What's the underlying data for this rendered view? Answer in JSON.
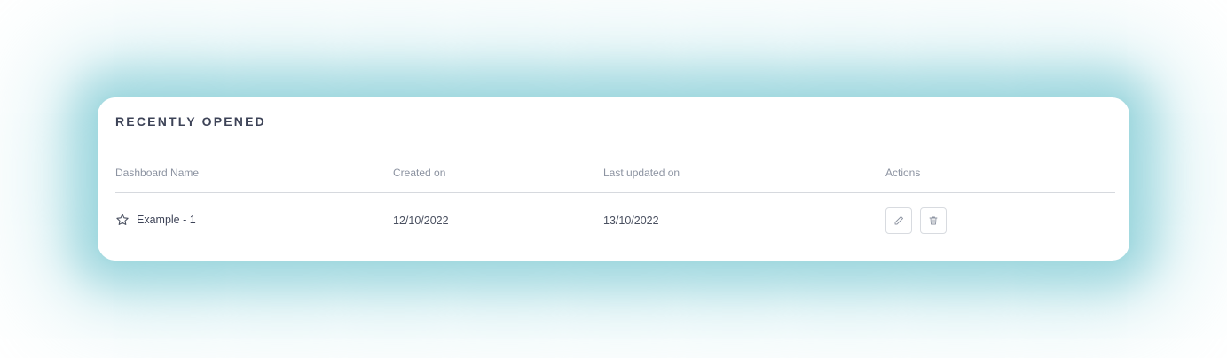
{
  "panel": {
    "title": "RECENTLY OPENED"
  },
  "table": {
    "columns": [
      "Dashboard Name",
      "Created on",
      "Last updated on",
      "Actions"
    ],
    "rows": [
      {
        "name": "Example - 1",
        "created_on": "12/10/2022",
        "last_updated_on": "13/10/2022",
        "favorite_icon": "star-outline-icon",
        "actions": [
          "edit-pencil-icon",
          "delete-trash-icon"
        ]
      }
    ]
  },
  "colors": {
    "glow": "#9bd6dc",
    "title_text": "#3d4357",
    "header_text": "#8c93a1",
    "divider": "#d6d9de"
  }
}
